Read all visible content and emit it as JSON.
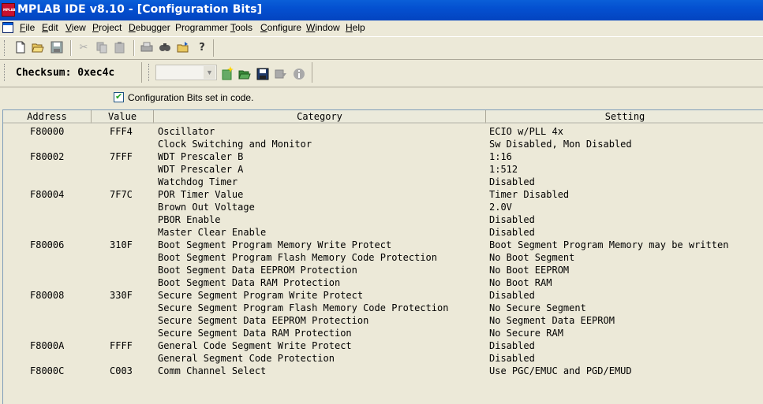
{
  "window": {
    "title": "MPLAB IDE v8.10 - [Configuration Bits]",
    "app_icon_text": "MPLAB"
  },
  "menu": [
    {
      "label": "File",
      "hotkey": "F",
      "rest": "ile"
    },
    {
      "label": "Edit",
      "hotkey": "E",
      "rest": "dit"
    },
    {
      "label": "View",
      "hotkey": "V",
      "rest": "iew"
    },
    {
      "label": "Project",
      "hotkey": "P",
      "rest": "roject"
    },
    {
      "label": "Debugger",
      "hotkey": "D",
      "rest": "ebugger"
    },
    {
      "label": "Programmer",
      "hotkey": "",
      "rest": "Programmer"
    },
    {
      "label": "Tools",
      "hotkey": "T",
      "rest": "ools"
    },
    {
      "label": "Configure",
      "hotkey": "C",
      "rest": "onfigure"
    },
    {
      "label": "Window",
      "hotkey": "W",
      "rest": "indow"
    },
    {
      "label": "Help",
      "hotkey": "H",
      "rest": "elp"
    }
  ],
  "toolbar": {
    "checksum": "Checksum: 0xec4c",
    "icons": [
      "new-file-icon",
      "open-folder-icon",
      "save-icon",
      "cut-icon",
      "copy-icon",
      "paste-icon",
      "print-icon",
      "find-icon",
      "open-file-icon",
      "help-icon"
    ]
  },
  "config": {
    "checkbox_label": "Configuration Bits set in code.",
    "checked": true,
    "columns": [
      "Address",
      "Value",
      "Category",
      "Setting"
    ],
    "rows": [
      [
        "F80000",
        "FFF4",
        "Oscillator",
        "ECIO w/PLL 4x"
      ],
      [
        "",
        "",
        "Clock Switching and Monitor",
        "Sw Disabled, Mon Disabled"
      ],
      [
        "F80002",
        "7FFF",
        "WDT Prescaler B",
        "1:16"
      ],
      [
        "",
        "",
        "WDT Prescaler A",
        "1:512"
      ],
      [
        "",
        "",
        "Watchdog Timer",
        "Disabled"
      ],
      [
        "F80004",
        "7F7C",
        "POR Timer Value",
        "Timer Disabled"
      ],
      [
        "",
        "",
        "Brown Out Voltage",
        "2.0V"
      ],
      [
        "",
        "",
        "PBOR Enable",
        "Disabled"
      ],
      [
        "",
        "",
        "Master Clear Enable",
        "Disabled"
      ],
      [
        "F80006",
        "310F",
        "Boot Segment Program Memory Write Protect",
        "Boot Segment Program Memory may be written"
      ],
      [
        "",
        "",
        "Boot Segment Program Flash Memory Code Protection",
        "No Boot Segment"
      ],
      [
        "",
        "",
        "Boot Segment Data EEPROM Protection",
        "No Boot EEPROM"
      ],
      [
        "",
        "",
        "Boot Segment Data RAM Protection",
        "No Boot RAM"
      ],
      [
        "F80008",
        "330F",
        "Secure Segment Program Write Protect",
        "Disabled"
      ],
      [
        "",
        "",
        "Secure Segment Program Flash Memory Code Protection",
        "No Secure Segment"
      ],
      [
        "",
        "",
        "Secure Segment Data EEPROM Protection",
        "No Segment Data EEPROM"
      ],
      [
        "",
        "",
        "Secure Segment Data RAM Protection",
        "No Secure RAM"
      ],
      [
        "F8000A",
        "FFFF",
        "General Code Segment Write Protect",
        "Disabled"
      ],
      [
        "",
        "",
        "General Segment Code Protection",
        "Disabled"
      ],
      [
        "F8000C",
        "C003",
        "Comm Channel Select",
        "Use PGC/EMUC and PGD/EMUD"
      ]
    ]
  }
}
